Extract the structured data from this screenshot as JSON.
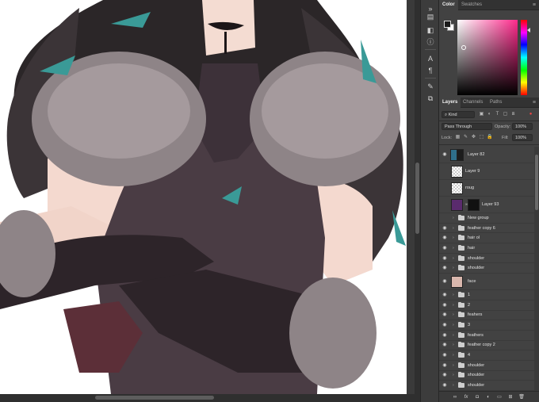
{
  "panel_tabs": {
    "color": "Color",
    "swatches": "Swatches",
    "layers": "Layers",
    "channels": "Channels",
    "paths": "Paths"
  },
  "layer_options": {
    "kind_filter": "Kind",
    "blend_mode": "Pass Through",
    "opacity_label": "Opacity:",
    "opacity_value": "100%",
    "lock_label": "Lock:",
    "fill_label": "Fill:",
    "fill_value": "100%"
  },
  "layers": [
    {
      "name": "Layer 82",
      "visible": true
    },
    {
      "name": "Layer 9",
      "visible": false
    },
    {
      "name": "roug",
      "visible": false
    },
    {
      "name": "Layer 93",
      "visible": false
    },
    {
      "name": "New group",
      "visible": false
    },
    {
      "name": "feather copy 6",
      "visible": true
    },
    {
      "name": "hair ol",
      "visible": true
    },
    {
      "name": "hair",
      "visible": true
    },
    {
      "name": "shoulder",
      "visible": true
    },
    {
      "name": "shoulder",
      "visible": true
    },
    {
      "name": "face",
      "visible": true
    },
    {
      "name": "1",
      "visible": true
    },
    {
      "name": "2",
      "visible": true
    },
    {
      "name": "feahers",
      "visible": true
    },
    {
      "name": "3",
      "visible": true
    },
    {
      "name": "feathers",
      "visible": true
    },
    {
      "name": "feather copy 2",
      "visible": true
    },
    {
      "name": "4",
      "visible": true
    },
    {
      "name": "shoulder",
      "visible": true
    },
    {
      "name": "shoulder",
      "visible": true
    },
    {
      "name": "shoulder",
      "visible": true
    }
  ],
  "colors": {
    "foreground": "#1a1a1a",
    "background": "#ffffff",
    "accent_hue": "#ff2a8c"
  },
  "icons": {
    "eye": "eye-icon",
    "folder": "folder-icon",
    "link": "link-icon",
    "fx": "fx-icon",
    "mask": "mask-icon",
    "adjustment": "adjustment-icon",
    "new_group": "new-group-icon",
    "new_layer": "new-layer-icon",
    "trash": "trash-icon"
  }
}
